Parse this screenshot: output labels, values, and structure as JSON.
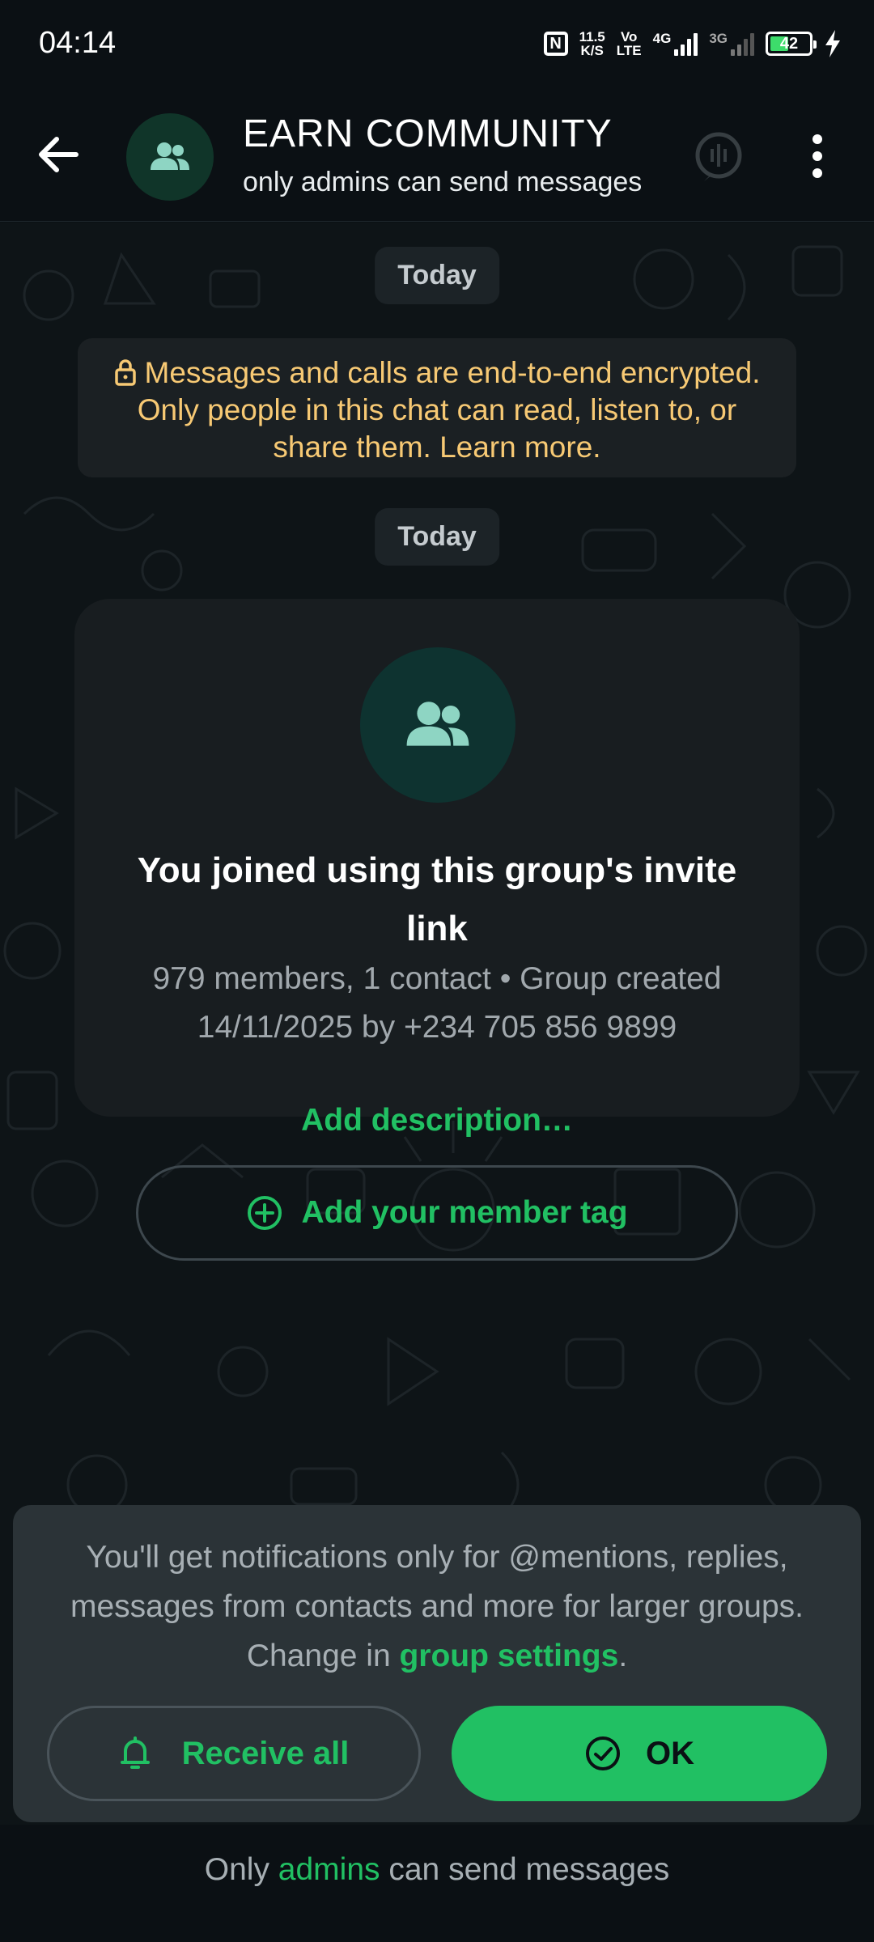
{
  "status_bar": {
    "time": "04:14",
    "net_speed_value": "11.5",
    "net_speed_unit": "K/S",
    "volte_top": "Vo",
    "volte_bottom": "LTE",
    "sim1_type": "4G",
    "sim2_type": "3G",
    "battery_level": "42",
    "icons": [
      "nfc-icon",
      "signal-icon",
      "battery-icon",
      "charging-icon"
    ]
  },
  "header": {
    "title": "EARN COMMUNITY",
    "subtitle": "only admins can send messages",
    "icons": [
      "back-arrow-icon",
      "group-icon",
      "call-icon",
      "more-vert-icon"
    ]
  },
  "chat": {
    "date_chip_1": "Today",
    "encryption_notice": "Messages and calls are end-to-end encrypted. Only people in this chat can read, listen to, or share them. Learn more.",
    "date_chip_2": "Today",
    "join_card": {
      "title": "You joined using this group's invite link",
      "meta": "979 members, 1 contact • Group created 14/11/2025 by +234 705 856 9899",
      "add_description": "Add description…",
      "member_tag_button": "Add your member tag"
    }
  },
  "notification_sheet": {
    "text_before": "You'll get notifications only for @mentions, replies, messages from contacts and more for larger groups. Change in ",
    "link": "group settings",
    "text_after": ".",
    "receive_all_label": "Receive all",
    "ok_label": "OK"
  },
  "footer": {
    "text_before": "Only ",
    "link": "admins",
    "text_after": " can send messages"
  },
  "colors": {
    "accent": "#21c063",
    "background": "#0b1014",
    "encryption_text": "#f7c974",
    "card": "#181d20",
    "sheet": "#2b3337"
  }
}
